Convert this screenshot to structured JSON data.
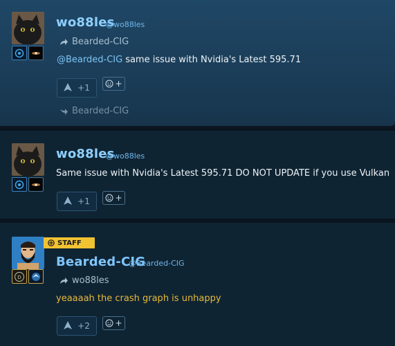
{
  "posts": [
    {
      "username": "wo88les",
      "handle": "@wo88les",
      "reply_to": "Bearded-CIG",
      "mention": "@Bearded-CIG",
      "body": "same issue with Nvidia's Latest 595.71",
      "votes": "+1",
      "footer_reply": "Bearded-CIG"
    },
    {
      "username": "wo88les",
      "handle": "@wo88les",
      "body": "Same issue with Nvidia's Latest 595.71 DO NOT UPDATE if you use Vulkan",
      "votes": "+1"
    },
    {
      "username": "Bearded-CIG",
      "handle": "@Bearded-CIG",
      "staff_label": "STAFF",
      "reply_to": "wo88les",
      "body": "yeaaaah the crash graph is unhappy",
      "votes": "+2"
    }
  ],
  "reaction_plus": "+",
  "colors": {
    "username": "#8fd0ff",
    "staff_accent": "#f1c232",
    "staff_text": "#e8b93a",
    "highlight_bg": "#1f4766",
    "post_bg": "#0f2433"
  },
  "icons": [
    "cat-avatar",
    "bearded-man-avatar",
    "reply-arrow-icon",
    "upvote-arrow-icon",
    "smiley-icon",
    "plus-icon",
    "staff-badge-icon"
  ]
}
